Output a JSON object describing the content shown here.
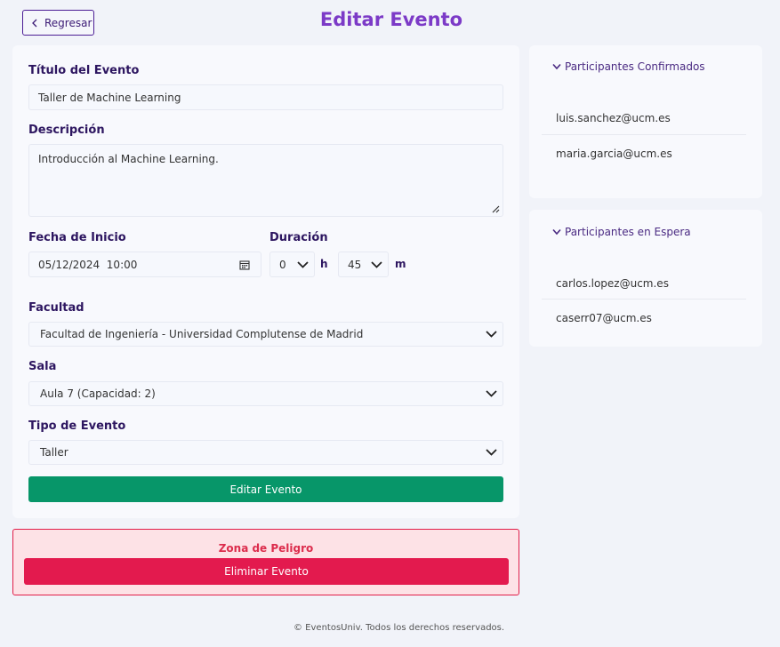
{
  "header": {
    "back_label": "Regresar",
    "title": "Editar Evento"
  },
  "form": {
    "title_label": "Título del Evento",
    "title_value": "Taller de Machine Learning",
    "description_label": "Descripción",
    "description_value": "Introducción al Machine Learning.",
    "start_label": "Fecha de Inicio",
    "start_value": "05/12/2024  10:00",
    "duration_label": "Duración",
    "duration_hours": "0",
    "duration_hours_unit": "h",
    "duration_minutes": "45",
    "duration_minutes_unit": "m",
    "faculty_label": "Facultad",
    "faculty_value": "Facultad de Ingeniería - Universidad Complutense de Madrid",
    "room_label": "Sala",
    "room_value": "Aula 7 (Capacidad: 2)",
    "type_label": "Tipo de Evento",
    "type_value": "Taller",
    "submit_label": "Editar Evento"
  },
  "danger": {
    "title": "Zona de Peligro",
    "delete_label": "Eliminar Evento"
  },
  "confirmed": {
    "heading": "Participantes Confirmados",
    "items": [
      "luis.sanchez@ucm.es",
      "maria.garcia@ucm.es"
    ]
  },
  "waiting": {
    "heading": "Participantes en Espera",
    "items": [
      "carlos.lopez@ucm.es",
      "caserr07@ucm.es"
    ]
  },
  "footer": {
    "text": "© EventosUniv. Todos los derechos reservados."
  },
  "colors": {
    "accent": "#7c3ac7",
    "submit": "#079669",
    "danger": "#e31a4e"
  }
}
